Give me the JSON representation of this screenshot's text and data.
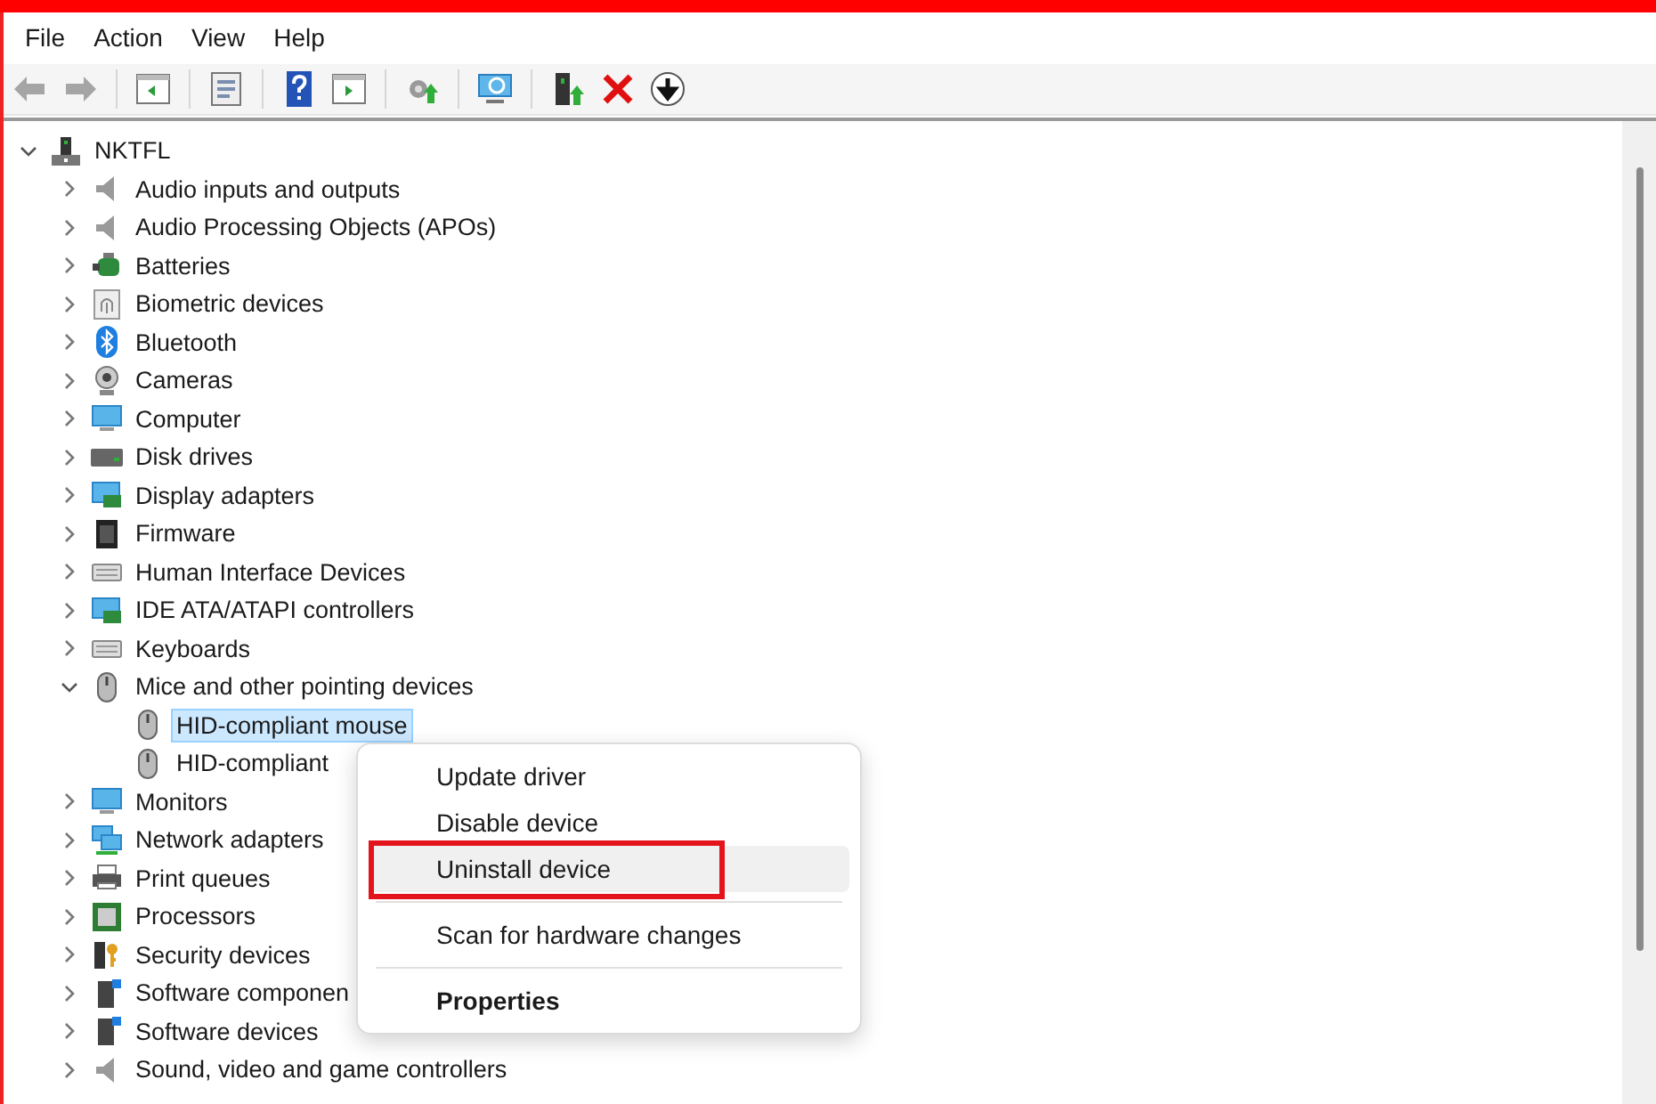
{
  "menu_bar": [
    "File",
    "Action",
    "View",
    "Help"
  ],
  "toolbar": [
    {
      "kind": "back",
      "disabled": true
    },
    {
      "kind": "forward",
      "disabled": true
    },
    {
      "kind": "separator"
    },
    {
      "kind": "console-tree",
      "disabled": false
    },
    {
      "kind": "separator"
    },
    {
      "kind": "properties",
      "disabled": false
    },
    {
      "kind": "separator"
    },
    {
      "kind": "help",
      "disabled": false
    },
    {
      "kind": "action-pane",
      "disabled": false
    },
    {
      "kind": "separator"
    },
    {
      "kind": "update-driver",
      "disabled": false
    },
    {
      "kind": "separator"
    },
    {
      "kind": "scan",
      "disabled": false
    },
    {
      "kind": "separator"
    },
    {
      "kind": "add-legacy",
      "disabled": false
    },
    {
      "kind": "uninstall",
      "disabled": false
    },
    {
      "kind": "disable",
      "disabled": false
    }
  ],
  "tree": [
    {
      "label": "NKTFL",
      "kind": "computer-node",
      "expanded": true,
      "selected": false,
      "children": [
        {
          "label": "Audio inputs and outputs",
          "kind": "speaker",
          "expanded": false,
          "selected": false
        },
        {
          "label": "Audio Processing Objects (APOs)",
          "kind": "speaker",
          "expanded": false,
          "selected": false
        },
        {
          "label": "Batteries",
          "kind": "battery",
          "expanded": false,
          "selected": false
        },
        {
          "label": "Biometric devices",
          "kind": "fingerprint",
          "expanded": false,
          "selected": false
        },
        {
          "label": "Bluetooth",
          "kind": "bluetooth",
          "expanded": false,
          "selected": false
        },
        {
          "label": "Cameras",
          "kind": "camera",
          "expanded": false,
          "selected": false
        },
        {
          "label": "Computer",
          "kind": "monitor",
          "expanded": false,
          "selected": false
        },
        {
          "label": "Disk drives",
          "kind": "disk",
          "expanded": false,
          "selected": false
        },
        {
          "label": "Display adapters",
          "kind": "display-card",
          "expanded": false,
          "selected": false
        },
        {
          "label": "Firmware",
          "kind": "chip",
          "expanded": false,
          "selected": false
        },
        {
          "label": "Human Interface Devices",
          "kind": "keyboard",
          "expanded": false,
          "selected": false
        },
        {
          "label": "IDE ATA/ATAPI controllers",
          "kind": "display-card",
          "expanded": false,
          "selected": false
        },
        {
          "label": "Keyboards",
          "kind": "keyboard",
          "expanded": false,
          "selected": false
        },
        {
          "label": "Mice and other pointing devices",
          "kind": "mouse",
          "expanded": true,
          "selected": false,
          "children": [
            {
              "label": "HID-compliant mouse",
              "kind": "mouse",
              "selected": true
            },
            {
              "label": "HID-compliant",
              "kind": "mouse",
              "selected": false
            }
          ]
        },
        {
          "label": "Monitors",
          "kind": "monitor",
          "expanded": false,
          "selected": false
        },
        {
          "label": "Network adapters",
          "kind": "network",
          "expanded": false,
          "selected": false
        },
        {
          "label": "Print queues",
          "kind": "printer",
          "expanded": false,
          "selected": false
        },
        {
          "label": "Processors",
          "kind": "processor",
          "expanded": false,
          "selected": false
        },
        {
          "label": "Security devices",
          "kind": "key",
          "expanded": false,
          "selected": false
        },
        {
          "label": "Software componen",
          "kind": "software",
          "expanded": false,
          "selected": false
        },
        {
          "label": "Software devices",
          "kind": "software",
          "expanded": false,
          "selected": false
        },
        {
          "label": "Sound, video and game controllers",
          "kind": "speaker",
          "expanded": false,
          "selected": false
        }
      ]
    }
  ],
  "context_menu": [
    {
      "kind": "item",
      "label": "Update driver",
      "highlighted": false,
      "annotated": false,
      "default": false
    },
    {
      "kind": "item",
      "label": "Disable device",
      "highlighted": false,
      "annotated": false,
      "default": false
    },
    {
      "kind": "item",
      "label": "Uninstall device",
      "highlighted": true,
      "annotated": true,
      "default": false
    },
    {
      "kind": "separator"
    },
    {
      "kind": "item",
      "label": "Scan for hardware changes",
      "highlighted": false,
      "annotated": false,
      "default": false
    },
    {
      "kind": "separator"
    },
    {
      "kind": "item",
      "label": "Properties",
      "highlighted": false,
      "annotated": false,
      "default": true
    }
  ]
}
